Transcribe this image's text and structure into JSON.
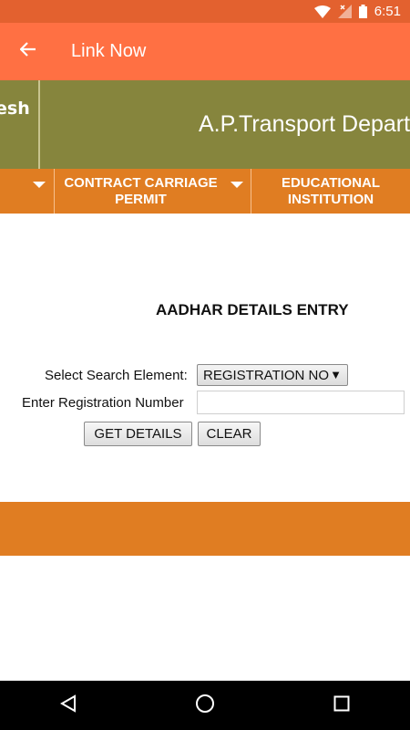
{
  "status_bar": {
    "time": "6:51",
    "bg_color": "#e3612f"
  },
  "app_bar": {
    "title": "Link Now",
    "bg_color": "#ff7043"
  },
  "banner": {
    "left_text": "esh",
    "title": "A.P.Transport Depart"
  },
  "nav": {
    "items": [
      {
        "label": ""
      },
      {
        "label": "CONTRACT CARRIAGE PERMIT"
      },
      {
        "label": "EDUCATIONAL INSTITUTION"
      }
    ],
    "bg_color": "#e07d22"
  },
  "form": {
    "heading": "AADHAR DETAILS ENTRY",
    "search_label": "Select Search Element:",
    "search_value": "REGISTRATION NO",
    "reg_label": "Enter Registration Number",
    "reg_value": "",
    "get_details_label": "GET DETAILS",
    "clear_label": "CLEAR"
  },
  "icons": {
    "back": "arrow-left-icon",
    "wifi": "wifi-icon",
    "signal": "signal-icon",
    "battery": "battery-icon",
    "nav_back": "triangle-back-icon",
    "nav_home": "circle-home-icon",
    "nav_recents": "square-recents-icon"
  }
}
